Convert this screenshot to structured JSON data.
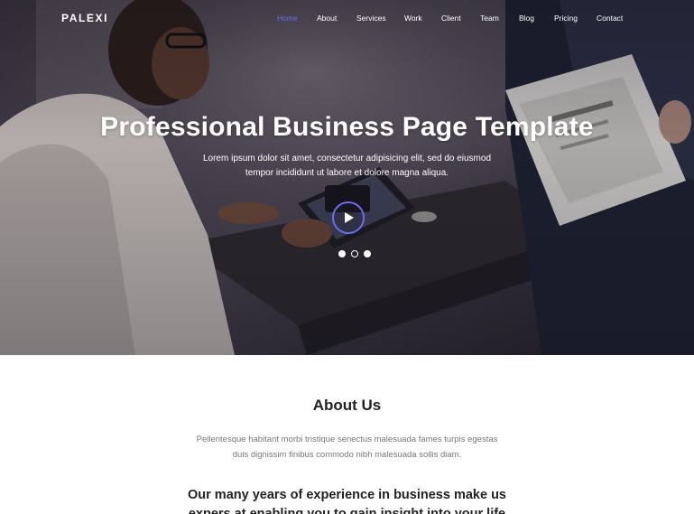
{
  "brand": "PALEXI",
  "nav": {
    "items": [
      {
        "label": "Home",
        "active": true
      },
      {
        "label": "About",
        "active": false
      },
      {
        "label": "Services",
        "active": false
      },
      {
        "label": "Work",
        "active": false
      },
      {
        "label": "Client",
        "active": false
      },
      {
        "label": "Team",
        "active": false
      },
      {
        "label": "Blog",
        "active": false
      },
      {
        "label": "Pricing",
        "active": false
      },
      {
        "label": "Contact",
        "active": false
      }
    ],
    "active_color": "#6c6cf0"
  },
  "hero": {
    "title": "Professional Business Page Template",
    "subtitle": "Lorem ipsum dolor sit amet, consectetur adipisicing elit, sed do eiusmod tempor incididunt ut labore et dolore magna aliqua.",
    "play_icon": "play-icon",
    "slides": {
      "count": 3,
      "active_index": 1
    },
    "accent": "#6b6cf0"
  },
  "about": {
    "title": "About Us",
    "text": "Pellentesque habitant morbi tristique senectus malesuada fames turpis egestas duis dignissim finibus commodo nibh malesuada sollis diam.",
    "headline": "Our many years of experience in business make us expers at enabling you to gain insight into your life"
  }
}
